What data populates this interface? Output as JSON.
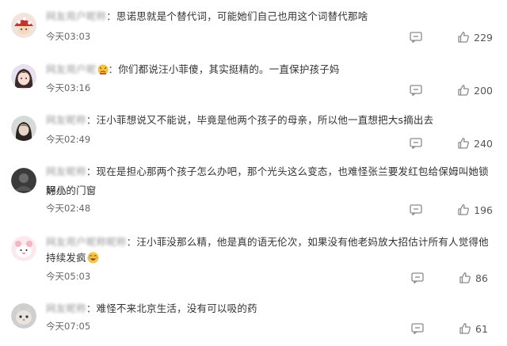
{
  "comments": [
    {
      "username": "网友用户昵称",
      "separator": "：",
      "text": "思诺思就是个替代词，可能她们自己也用这个词替代那啥",
      "time": "今天03:03",
      "likes": "229",
      "avatar_icon": "mushroom-avatar-icon"
    },
    {
      "username": "网友用户昵",
      "separator": "：",
      "text": "你们都说汪小菲傻，其实挺精的。一直保护孩子妈",
      "time": "今天03:16",
      "likes": "200",
      "avatar_icon": "girl-avatar-icon"
    },
    {
      "username": "网友昵称",
      "separator": "：",
      "text": "汪小菲想说又不能说，毕竟是他两个孩子的母亲，所以他一直想把大s摘出去",
      "time": "今天02:49",
      "likes": "240",
      "avatar_icon": "portrait-avatar-icon"
    },
    {
      "username": "网友昵称",
      "separator": "：",
      "text_line1": "现在是担心那两个孩子怎么办吧，那个光头这么变态，也难怪张兰要发红包给保姆叫她锁好小",
      "text_line2": "玥儿的门窗",
      "time": "今天02:48",
      "likes": "196",
      "avatar_icon": "dark-avatar-icon"
    },
    {
      "username": "网友用户昵称昵称",
      "separator": "：",
      "text_line1": "汪小菲没那么精，他是真的语无伦次，如果没有他老妈放大招估计所有人觉得他",
      "text_line2": "持续发疯",
      "time": "今天05:03",
      "likes": "86",
      "avatar_icon": "pink-cartoon-avatar-icon"
    },
    {
      "username": "网友昵称",
      "separator": "：",
      "text": "难怪不来北京生活，没有可以吸的药",
      "time": "今天07:05",
      "likes": "61",
      "avatar_icon": "cat-avatar-icon"
    }
  ],
  "icons": {
    "reply": "comment-bubble-icon",
    "like": "thumbs-up-icon"
  },
  "colors": {
    "text": "#333333",
    "meta": "#666666",
    "icon": "#8a8a8a"
  }
}
